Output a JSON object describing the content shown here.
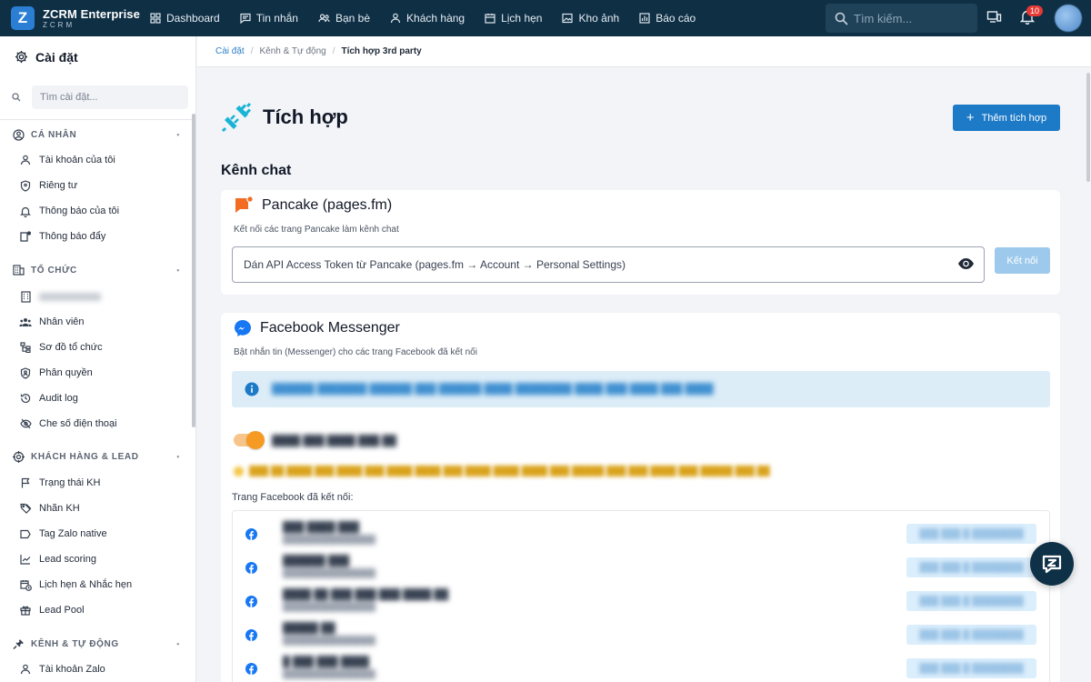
{
  "app": {
    "brand_name": "ZCRM Enterprise",
    "brand_sub": "ZCRM",
    "brand_logo": "Z"
  },
  "topnav": [
    {
      "label": "Dashboard",
      "icon": "dashboard-icon"
    },
    {
      "label": "Tin nhắn",
      "icon": "message-icon"
    },
    {
      "label": "Bạn bè",
      "icon": "friends-icon"
    },
    {
      "label": "Khách hàng",
      "icon": "customer-icon"
    },
    {
      "label": "Lịch hẹn",
      "icon": "calendar-icon"
    },
    {
      "label": "Kho ảnh",
      "icon": "image-library-icon"
    },
    {
      "label": "Báo cáo",
      "icon": "report-icon"
    }
  ],
  "search": {
    "placeholder": "Tìm kiếm..."
  },
  "notifications": {
    "count": "10"
  },
  "sidebar": {
    "title": "Cài đặt",
    "search_placeholder": "Tìm cài đặt...",
    "sections": [
      {
        "label": "CÁ NHÂN",
        "icon": "user-circle-icon",
        "items": [
          {
            "label": "Tài khoản của tôi",
            "icon": "person-icon"
          },
          {
            "label": "Riêng tư",
            "icon": "shield-icon"
          },
          {
            "label": "Thông báo của tôi",
            "icon": "bell-icon"
          },
          {
            "label": "Thông báo đẩy",
            "icon": "push-notification-icon"
          }
        ]
      },
      {
        "label": "TỔ CHỨC",
        "icon": "building-icon",
        "items": [
          {
            "label": "",
            "icon": "building-icon"
          },
          {
            "label": "Nhân viên",
            "icon": "people-icon"
          },
          {
            "label": "Sơ đồ tổ chức",
            "icon": "org-chart-icon"
          },
          {
            "label": "Phân quyền",
            "icon": "security-icon"
          },
          {
            "label": "Audit log",
            "icon": "history-icon"
          },
          {
            "label": "Che số điện thoại",
            "icon": "eye-off-icon"
          }
        ]
      },
      {
        "label": "KHÁCH HÀNG & LEAD",
        "icon": "target-icon",
        "items": [
          {
            "label": "Trạng thái KH",
            "icon": "flag-icon"
          },
          {
            "label": "Nhãn KH",
            "icon": "tags-icon"
          },
          {
            "label": "Tag Zalo native",
            "icon": "label-icon"
          },
          {
            "label": "Lead scoring",
            "icon": "trend-icon"
          },
          {
            "label": "Lịch hẹn & Nhắc hẹn",
            "icon": "calendar-clock-icon"
          },
          {
            "label": "Lead Pool",
            "icon": "gift-box-icon"
          }
        ]
      },
      {
        "label": "KÊNH & TỰ ĐỘNG",
        "icon": "plug-icon",
        "items": [
          {
            "label": "Tài khoản Zalo",
            "icon": "person-icon"
          }
        ]
      }
    ]
  },
  "breadcrumb": {
    "items": [
      "Cài đặt",
      "Kênh & Tự động"
    ],
    "current": "Tích hợp 3rd party"
  },
  "page": {
    "title": "Tích hợp",
    "add_button": "Thêm tích hợp",
    "section_title": "Kênh chat"
  },
  "pancake": {
    "title": "Pancake (pages.fm)",
    "description": "Kết nối các trang Pancake làm kênh chat",
    "token_placeholder": "Dán API Access Token từ Pancake (pages.fm → Account → Personal Settings)",
    "connect_label": "Kết nối"
  },
  "facebook": {
    "title": "Facebook Messenger",
    "description": "Bật nhắn tin (Messenger) cho các trang Facebook đã kết nối",
    "pages_label": "Trang Facebook đã kết nối:",
    "toggle_on": true
  },
  "colors": {
    "topbar": "#0f2f45",
    "accent": "#1d7ac7",
    "toggle": "#f59a23",
    "pancake": "#f26c22",
    "messenger": "#1877f2"
  }
}
